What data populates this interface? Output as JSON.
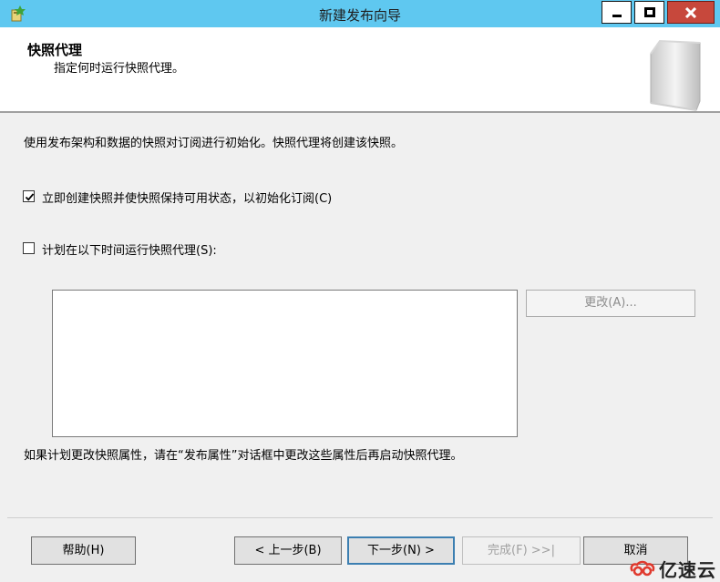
{
  "window": {
    "title": "新建发布向导"
  },
  "header": {
    "title": "快照代理",
    "subtitle": "指定何时运行快照代理。"
  },
  "content": {
    "description": "使用发布架构和数据的快照对订阅进行初始化。快照代理将创建该快照。",
    "create_now": {
      "label": "立即创建快照并使快照保持可用状态，以初始化订阅(C)",
      "checked": true
    },
    "schedule": {
      "label": "计划在以下时间运行快照代理(S):",
      "checked": false
    },
    "change_button": "更改(A)...",
    "note": "如果计划更改快照属性，请在“发布属性”对话框中更改这些属性后再启动快照代理。"
  },
  "footer": {
    "help": "帮助(H)",
    "back": "< 上一步(B)",
    "next": "下一步(N) >",
    "finish": "完成(F) >>|",
    "cancel": "取消"
  },
  "watermark": {
    "text": "亿速云"
  },
  "colors": {
    "titlebar": "#5FC8F0",
    "close": "#C7483C",
    "next_border": "#3C7FB1"
  }
}
